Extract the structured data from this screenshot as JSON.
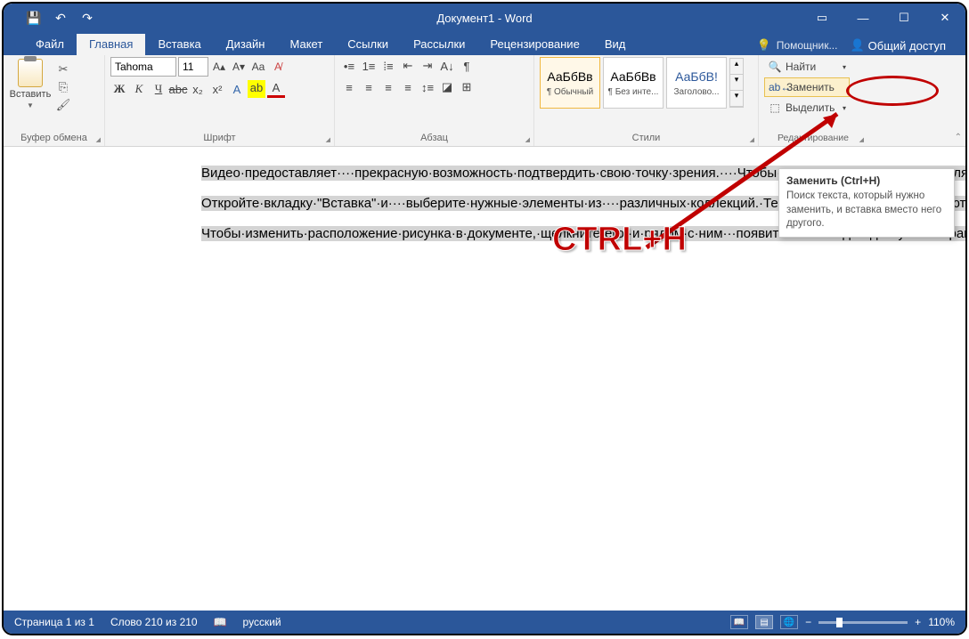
{
  "title": "Документ1 - Word",
  "qat": {
    "save": "save-icon",
    "undo": "undo-icon",
    "redo": "redo-icon"
  },
  "tabs": {
    "file": "Файл",
    "home": "Главная",
    "insert": "Вставка",
    "design": "Дизайн",
    "layout": "Макет",
    "references": "Ссылки",
    "mailings": "Рассылки",
    "review": "Рецензирование",
    "view": "Вид",
    "tell_me": "Помощник...",
    "share": "Общий доступ"
  },
  "ribbon": {
    "clipboard": {
      "label": "Буфер обмена",
      "paste": "Вставить"
    },
    "font": {
      "label": "Шрифт",
      "name": "Tahoma",
      "size": "11"
    },
    "paragraph": {
      "label": "Абзац"
    },
    "styles": {
      "label": "Стили",
      "items": [
        {
          "sample": "АаБбВв",
          "name": "¶ Обычный"
        },
        {
          "sample": "АаБбВв",
          "name": "¶ Без инте..."
        },
        {
          "sample": "АаБбВ!",
          "name": "Заголово..."
        }
      ]
    },
    "editing": {
      "label": "Редактирование",
      "find": "Найти",
      "replace": "Заменить",
      "select": "Выделить"
    }
  },
  "tooltip": {
    "title": "Заменить (Ctrl+H)",
    "body": "Поиск текста, который нужно заменить, и вставка вместо него другого."
  },
  "annotation": "CTRL+H",
  "document": {
    "p1": "Видео·предоставляет····прекрасную·возможность·подтвердить·свою·точку·зрения.····Чтобы···вставить·код·внедрения·для·видео,·которое·вы·хотите·добавить,·нажмите··\"Видео·в·сети\".·Вы·также·можете·ввести·ключевое·слово,····чтобы·найти·в·Интернете·видео,·которое···лучше·всего·подходит···для·вашего·документа.·Чтобы···придать····документу···профессиональный·вид,·воспользуйтесь···доступными····Word····наборами·верхних·и·нижних···колонтитулов,···титульной·страницы·и·текстовых·полей,·которые····дополняют·друг·друга.·Например,····вы·можете·добавить····подходящую·титульную·страницу,·верхний····колонтитул·и·боковое·примечание.·",
    "p2": "Откройте·вкладку·\"Вставка\"·и····выберите·нужные·элементы·из····различных·коллекций.·Темы·и·стили····также·помогают·придать·документу·единообразный·вид.····Если·на·вкладке···\"Конструктор\"·выбрать·другую·тему,····то·изображения,·диаграммы·и·графические·элементы·SmartArt····изменятся·соответствующим·образом.··При·применении·стилей···заголовки·изменяются·в·соответствии····с·новой·темой.·Новые·кнопки,·которые·видны,··только·если·они·действительно·нужны,·экономят·время·при·работе·в·Word.",
    "p3": "Чтобы·изменить·расположение·рисунка·в·документе,·щелкните·его,·и·рядом·с·ним···появится·кнопка·для·доступа·к·параметрам·разметки.·При·работе·с·таблицей·щелкните·то···место,·куда·нужно·добавить·строку·или·столбец,·и·щелкните·знак·\"плюс\".·Читать·тоже····стало·проще·благодаря·новому·режиму·чтения.·Можно·свернуть·части·документа,·чтобы···сосредоточиться·на·нужном·фрагменте·текста.·Если·вы·прервете·чтение,·не·дойдя·до···конца·документа,·Word·запомнит,·в·каком·месте·вы·остановились·(даже·на·другом···устройстве)."
  },
  "statusbar": {
    "page": "Страница 1 из 1",
    "words": "Слово 210 из 210",
    "lang": "русский",
    "zoom": "110%"
  }
}
